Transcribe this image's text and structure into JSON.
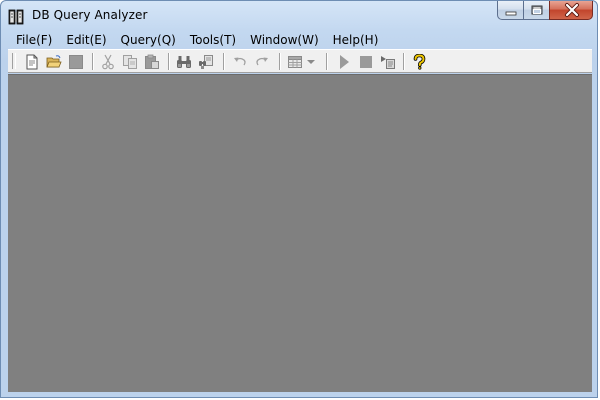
{
  "window": {
    "title": "DB Query Analyzer",
    "app_icon": "book-db-icon",
    "caption_buttons": [
      "minimize-icon",
      "maximize-icon",
      "close-icon"
    ]
  },
  "menu": {
    "items": [
      {
        "label": "File(F)"
      },
      {
        "label": "Edit(E)"
      },
      {
        "label": "Query(Q)"
      },
      {
        "label": "Tools(T)"
      },
      {
        "label": "Window(W)"
      },
      {
        "label": "Help(H)"
      }
    ]
  },
  "toolbar": {
    "buttons": [
      {
        "icon": "new-document-icon",
        "enabled": true
      },
      {
        "icon": "open-folder-icon",
        "enabled": true
      },
      {
        "icon": "save-icon",
        "enabled": false
      },
      {
        "icon": "cut-icon",
        "enabled": false
      },
      {
        "icon": "copy-icon",
        "enabled": false
      },
      {
        "icon": "paste-icon",
        "enabled": false
      },
      {
        "icon": "find-icon",
        "enabled": false
      },
      {
        "icon": "replace-icon",
        "enabled": false
      },
      {
        "icon": "undo-icon",
        "enabled": false
      },
      {
        "icon": "redo-icon",
        "enabled": false
      },
      {
        "icon": "results-grid-icon",
        "enabled": false
      },
      {
        "icon": "dropdown-arrow-icon",
        "enabled": false
      },
      {
        "icon": "execute-icon",
        "enabled": false
      },
      {
        "icon": "stop-icon",
        "enabled": false
      },
      {
        "icon": "execute-selection-icon",
        "enabled": false
      },
      {
        "icon": "help-icon",
        "enabled": true
      }
    ]
  },
  "colors": {
    "client_background": "#808080",
    "toolbar_background": "#f0f0f0",
    "close_button": "#c2452c",
    "disabled_icon": "#a0a0a0",
    "help_icon": "#f0c800"
  }
}
